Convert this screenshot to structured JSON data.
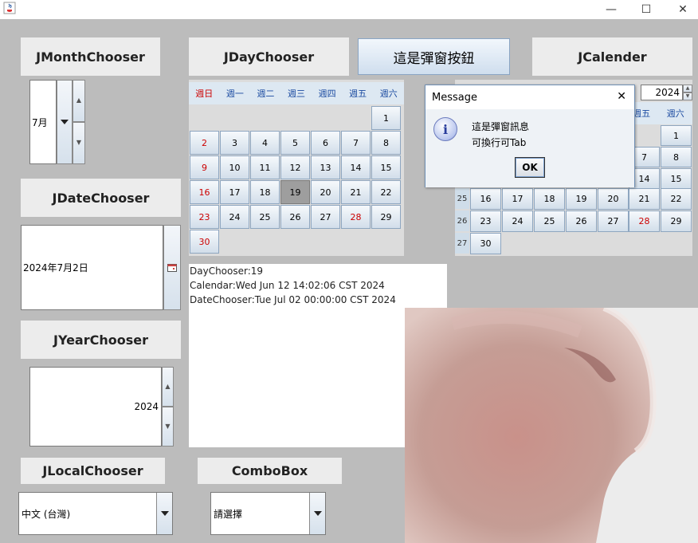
{
  "window": {
    "minimize_glyph": "—",
    "maximize_glyph": "☐",
    "close_glyph": "✕"
  },
  "labels": {
    "month_chooser": "JMonthChooser",
    "day_chooser": "JDayChooser",
    "popup_button": "這是彈窗按鈕",
    "calendar": "JCalender",
    "date_chooser": "JDateChooser",
    "year_chooser": "JYearChooser",
    "locale_chooser": "JLocalChooser",
    "combo_box": "ComboBox"
  },
  "month_chooser": {
    "value": "7月"
  },
  "date_chooser": {
    "value": "2024年7月2日"
  },
  "year_chooser": {
    "value": "2024"
  },
  "locale_chooser": {
    "value": "中文 (台灣)"
  },
  "combo_box": {
    "value": "請選擇"
  },
  "weekdays": [
    "週日",
    "週一",
    "週二",
    "週三",
    "週四",
    "週五",
    "週六"
  ],
  "day_chooser": {
    "selected": "19",
    "days": [
      "1",
      "2",
      "3",
      "4",
      "5",
      "6",
      "7",
      "8",
      "9",
      "10",
      "11",
      "12",
      "13",
      "14",
      "15",
      "16",
      "17",
      "18",
      "19",
      "20",
      "21",
      "22",
      "23",
      "24",
      "25",
      "26",
      "27",
      "28",
      "29",
      "30"
    ]
  },
  "calendar": {
    "year": "2024",
    "visible_weekday": "週五",
    "visible_weekday_2": "週六",
    "weeks": [
      "25",
      "26",
      "27"
    ],
    "days": {
      "row1": [
        "1"
      ],
      "row2": [
        "7",
        "8"
      ],
      "row3": [
        "14",
        "15"
      ],
      "row4": [
        "16",
        "17",
        "18",
        "19",
        "20",
        "21",
        "22"
      ],
      "row5": [
        "23",
        "24",
        "25",
        "26",
        "27",
        "28",
        "29"
      ],
      "row6": [
        "30"
      ]
    }
  },
  "output": {
    "line1": "DayChooser:19",
    "line2": "Calendar:Wed Jun 12 14:02:06 CST 2024",
    "line3": "DateChooser:Tue Jul 02 00:00:00 CST 2024"
  },
  "dialog": {
    "title": "Message",
    "line1": "這是彈窗訊息",
    "line2": "可換行可Tab",
    "ok": "OK",
    "close_glyph": "✕",
    "info_glyph": "i"
  },
  "colors": {
    "sunday": "#cc0000",
    "weekday_header": "#1a4aa0",
    "selected_day": "#9e9e9e"
  }
}
